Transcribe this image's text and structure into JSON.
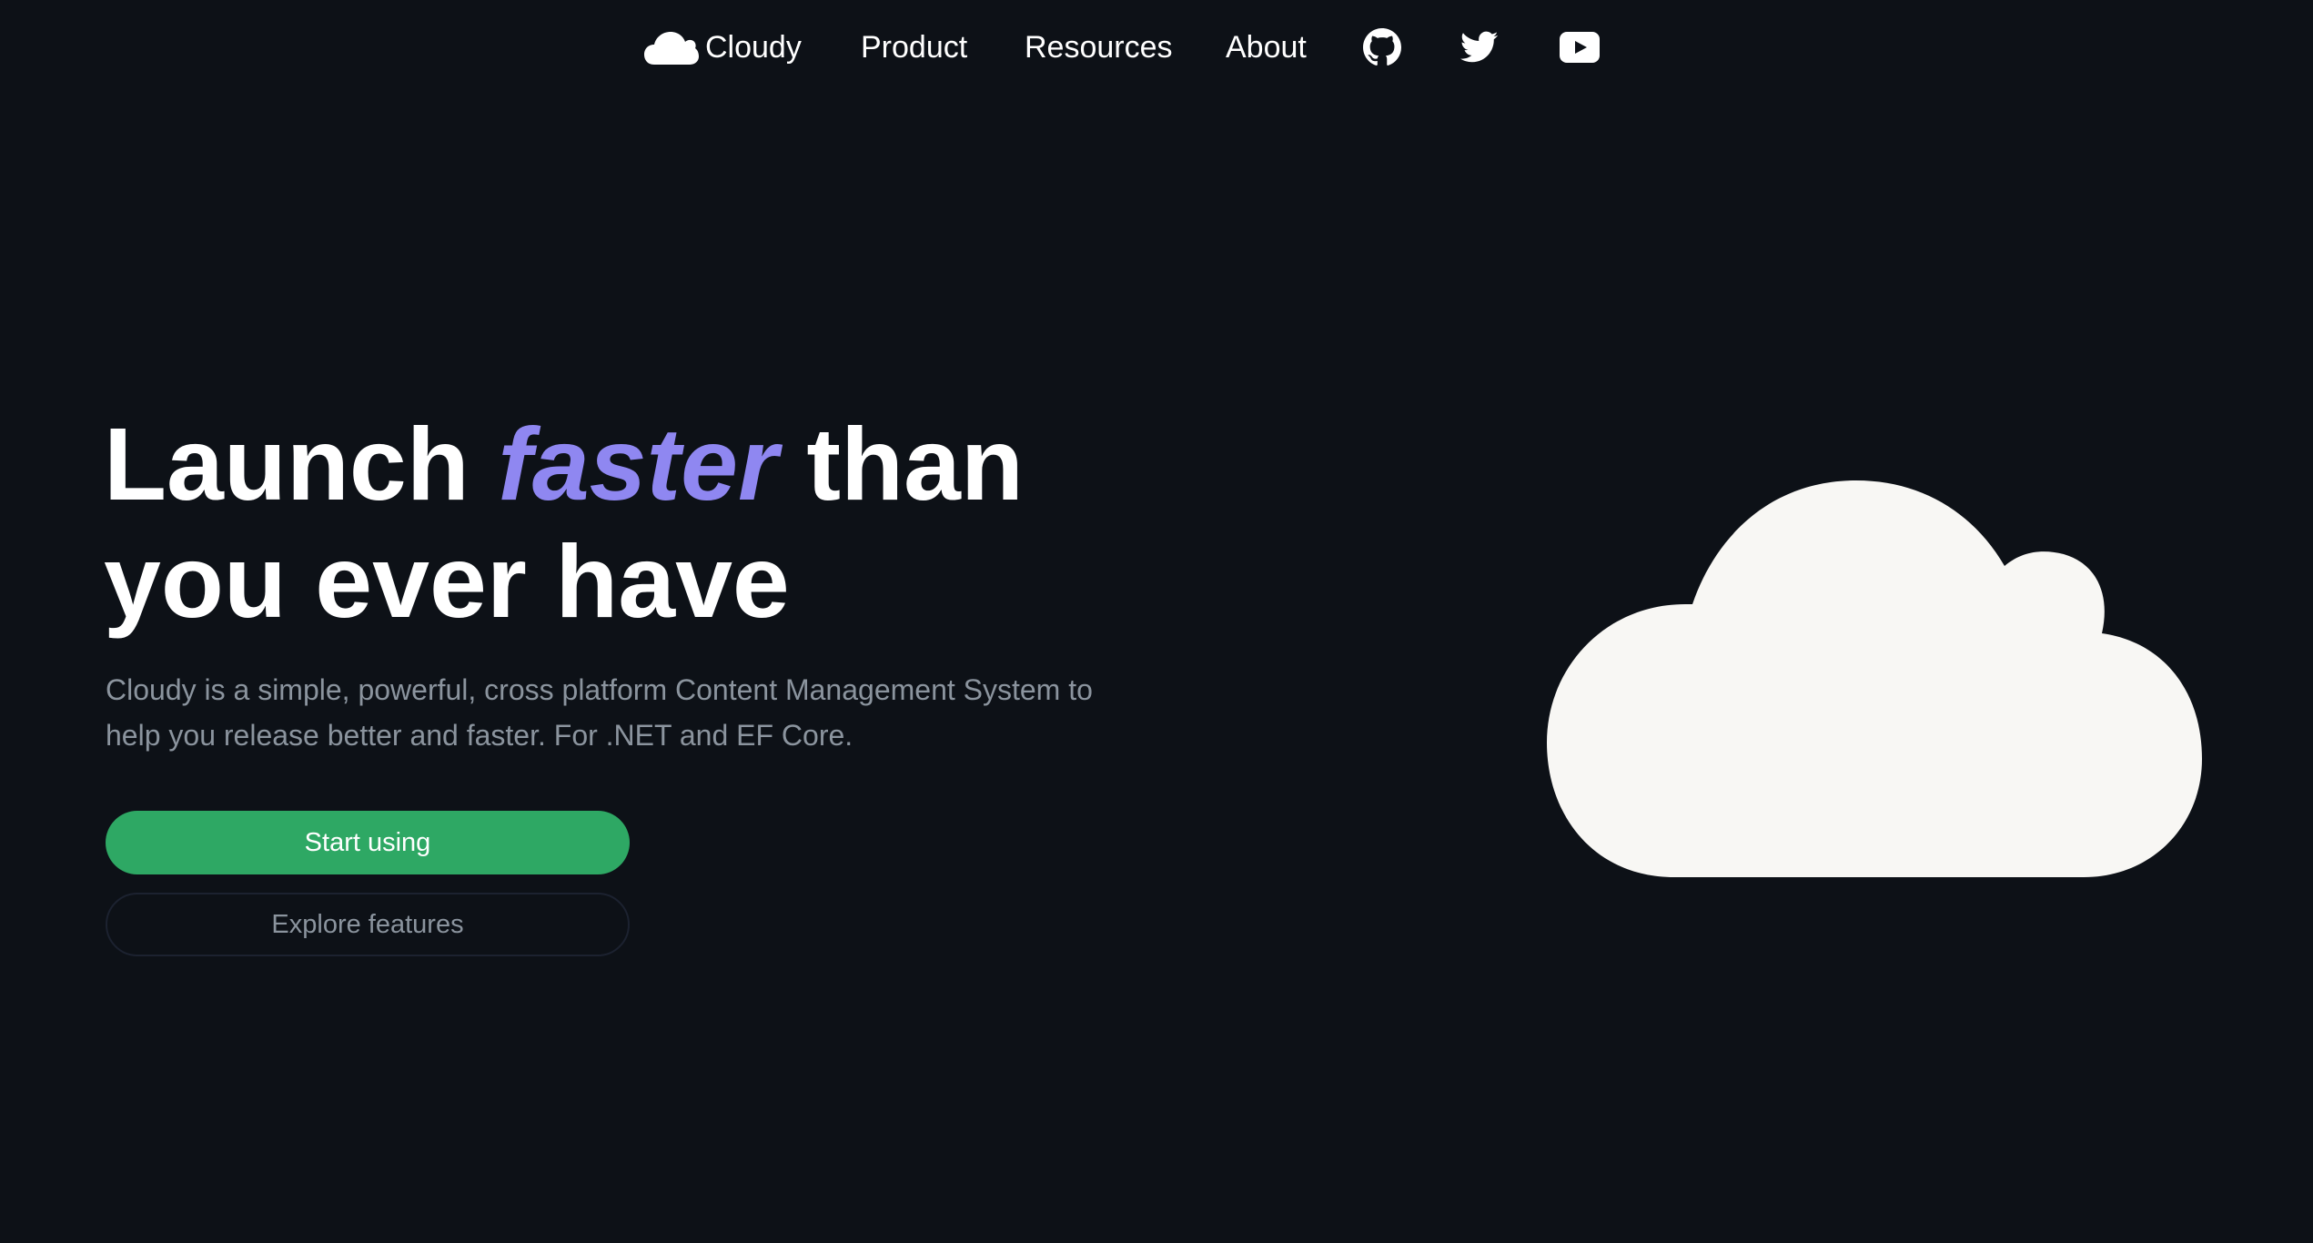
{
  "nav": {
    "brand": {
      "label": "Cloudy",
      "icon": "cloud-icon"
    },
    "links": {
      "product": "Product",
      "resources": "Resources",
      "about": "About"
    },
    "social_icons": [
      "github-icon",
      "twitter-icon",
      "youtube-icon"
    ]
  },
  "hero": {
    "title_part1": "Launch",
    "title_accent": "faster",
    "title_part2": "than you ever have",
    "description": "Cloudy is a simple, powerful, cross platform Content Management System to help you release better and faster. For .NET and EF Core.",
    "primary_button": "Start using",
    "secondary_button": "Explore features",
    "illustration_icon": "cloud-icon"
  },
  "colors": {
    "background": "#0d1117",
    "accent": "#8f87f1",
    "primary_button": "#2ea864",
    "muted_text": "#8b949e",
    "cloud_fill": "#f8f7f4"
  }
}
